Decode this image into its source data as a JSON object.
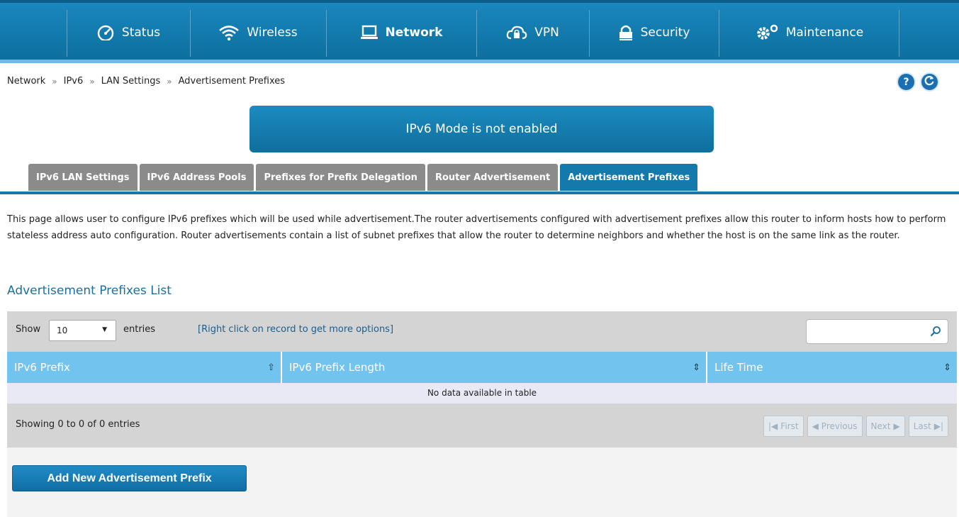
{
  "nav": {
    "items": [
      {
        "label": "Status",
        "icon": "dashboard-gauge-icon"
      },
      {
        "label": "Wireless",
        "icon": "wifi-icon"
      },
      {
        "label": "Network",
        "icon": "monitor-icon"
      },
      {
        "label": "VPN",
        "icon": "cloud-lock-icon"
      },
      {
        "label": "Security",
        "icon": "padlock-icon"
      },
      {
        "label": "Maintenance",
        "icon": "gears-icon"
      }
    ],
    "active": "Network"
  },
  "breadcrumb": [
    "Network",
    "IPv6",
    "LAN Settings",
    "Advertisement Prefixes"
  ],
  "breadcrumb_sep": "»",
  "help_label": "?",
  "banner": "IPv6 Mode is not enabled",
  "tabs": [
    {
      "label": "IPv6 LAN Settings"
    },
    {
      "label": "IPv6 Address Pools"
    },
    {
      "label": "Prefixes for Prefix Delegation"
    },
    {
      "label": "Router Advertisement"
    },
    {
      "label": "Advertisement Prefixes"
    }
  ],
  "active_tab": "Advertisement Prefixes",
  "description": "This page allows user to configure IPv6 prefixes which will be used while advertisement.The router advertisements configured with advertisement prefixes allow this router to inform hosts how to perform stateless address auto configuration. Router advertisements contain a list of subnet prefixes that allow the router to determine neighbors and whether the host is on the same link as the router.",
  "list_title": "Advertisement Prefixes List",
  "toolbar": {
    "show_label": "Show",
    "show_value": "10",
    "entries_label": "entries",
    "hint": "[Right click on record to get more options]",
    "search_value": ""
  },
  "table": {
    "columns": [
      "IPv6 Prefix",
      "IPv6 Prefix Length",
      "Life Time"
    ],
    "empty_message": "No data available in table",
    "info": "Showing 0 to 0 of 0 entries"
  },
  "pager": {
    "first": "First",
    "previous": "Previous",
    "next": "Next",
    "last": "Last"
  },
  "add_button": "Add New Advertisement Prefix",
  "colors": {
    "brand_blue": "#1479ab",
    "header_blue": "#73c3ef",
    "inactive_tab": "#8b8b8b"
  }
}
